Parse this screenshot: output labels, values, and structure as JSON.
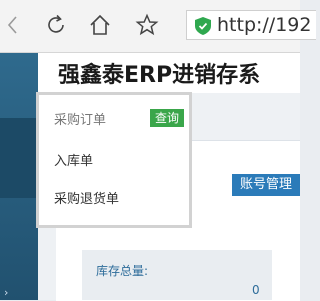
{
  "browser": {
    "url": "http://192"
  },
  "header": {
    "title": "强鑫泰ERP进销存系"
  },
  "menu": {
    "items": [
      {
        "label": "采购订单",
        "badge": "查询"
      },
      {
        "label": "入库单"
      },
      {
        "label": "采购退货单"
      }
    ]
  },
  "main": {
    "account_button": "账号管理",
    "stock": {
      "label": "库存总量:",
      "value": "0"
    }
  },
  "colors": {
    "sidebar": "#2b5f82",
    "accent": "#2b7bb9",
    "badge_green": "#3aa64a"
  }
}
